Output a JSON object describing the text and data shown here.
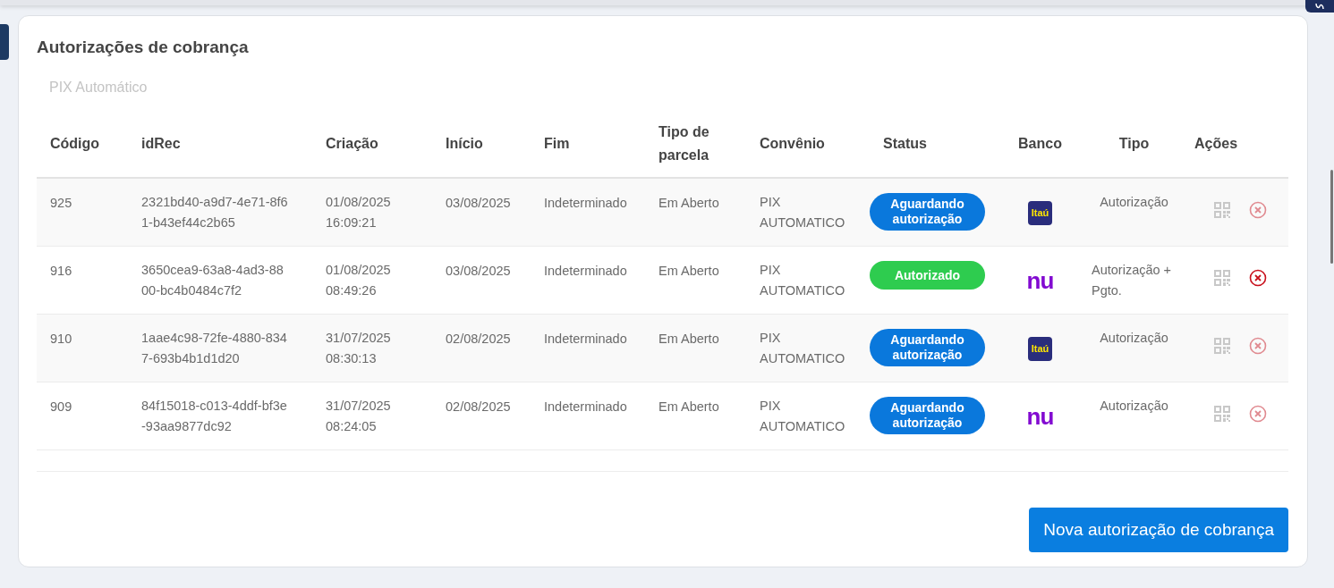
{
  "card": {
    "title": "Autorizações de cobrança",
    "subtitle": "PIX Automático"
  },
  "table": {
    "columns": [
      "Código",
      "idRec",
      "Criação",
      "Início",
      "Fim",
      "Tipo de parcela",
      "Convênio",
      "Status",
      "Banco",
      "Tipo",
      "Ações"
    ],
    "rows": [
      {
        "codigo": "925",
        "idrec": "2321bd40-a9d7-4e71-8f61-b43ef44c2b65",
        "criacao": [
          "01/08/2025",
          "16:09:21"
        ],
        "inicio": "03/08/2025",
        "fim": "Indeterminado",
        "tipo_parcela": "Em Aberto",
        "convenio": "PIX AUTOMATICO",
        "status": {
          "kind": "pending",
          "label": "Aguardando autorização"
        },
        "bank": {
          "kind": "itau",
          "logo_text": "Itaú"
        },
        "tipo": "Autorização",
        "cancel_disabled": true
      },
      {
        "codigo": "916",
        "idrec": "3650cea9-63a8-4ad3-8800-bc4b0484c7f2",
        "criacao": [
          "01/08/2025",
          "08:49:26"
        ],
        "inicio": "03/08/2025",
        "fim": "Indeterminado",
        "tipo_parcela": "Em Aberto",
        "convenio": "PIX AUTOMATICO",
        "status": {
          "kind": "authorized",
          "label": "Autorizado"
        },
        "bank": {
          "kind": "nubank",
          "logo_text": "nu"
        },
        "tipo": "Autorização + Pgto.",
        "cancel_disabled": false
      },
      {
        "codigo": "910",
        "idrec": "1aae4c98-72fe-4880-8347-693b4b1d1d20",
        "criacao": [
          "31/07/2025",
          "08:30:13"
        ],
        "inicio": "02/08/2025",
        "fim": "Indeterminado",
        "tipo_parcela": "Em Aberto",
        "convenio": "PIX AUTOMATICO",
        "status": {
          "kind": "pending",
          "label": "Aguardando autorização"
        },
        "bank": {
          "kind": "itau",
          "logo_text": "Itaú"
        },
        "tipo": "Autorização",
        "cancel_disabled": true
      },
      {
        "codigo": "909",
        "idrec": "84f15018-c013-4ddf-bf3e-93aa9877dc92",
        "criacao": [
          "31/07/2025",
          "08:24:05"
        ],
        "inicio": "02/08/2025",
        "fim": "Indeterminado",
        "tipo_parcela": "Em Aberto",
        "convenio": "PIX AUTOMATICO",
        "status": {
          "kind": "pending",
          "label": "Aguardando autorização"
        },
        "bank": {
          "kind": "nubank",
          "logo_text": "nu"
        },
        "tipo": "Autorização",
        "cancel_disabled": true
      }
    ]
  },
  "new_button": "Nova autorização de cobrança"
}
